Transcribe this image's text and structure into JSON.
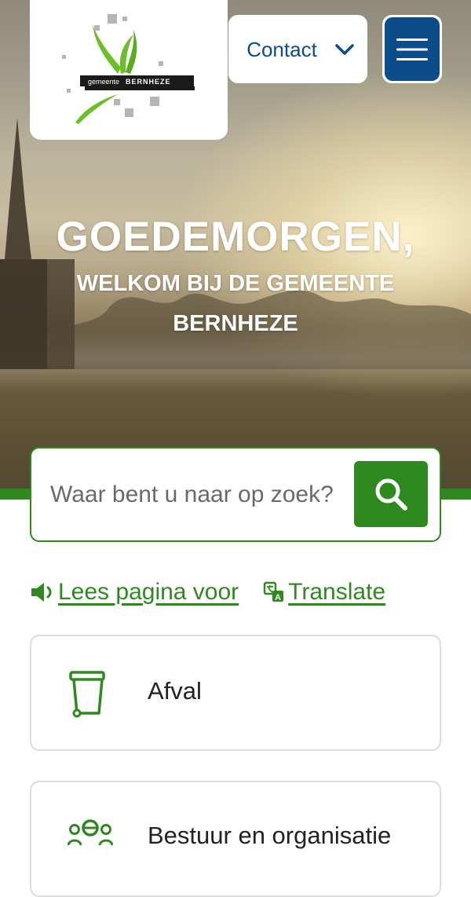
{
  "header": {
    "logo_text_small": "gemeente",
    "logo_text_big": "BERNHEZE",
    "contact_label": "Contact",
    "menu_icon": "hamburger-icon"
  },
  "hero": {
    "greeting": "GOEDEMORGEN,",
    "welcome": "WELKOM BIJ DE GEMEENTE BERNHEZE"
  },
  "search": {
    "placeholder": "Waar bent u naar op zoek?",
    "icon": "search-icon"
  },
  "links": {
    "read_aloud": "Lees pagina voor",
    "translate": "Translate"
  },
  "cards": [
    {
      "label": "Afval",
      "icon": "waste-bin-icon"
    },
    {
      "label": "Bestuur en organisatie",
      "icon": "people-group-icon"
    }
  ],
  "colors": {
    "brand_green": "#2e8a1f",
    "brand_blue": "#0b4d8a"
  }
}
